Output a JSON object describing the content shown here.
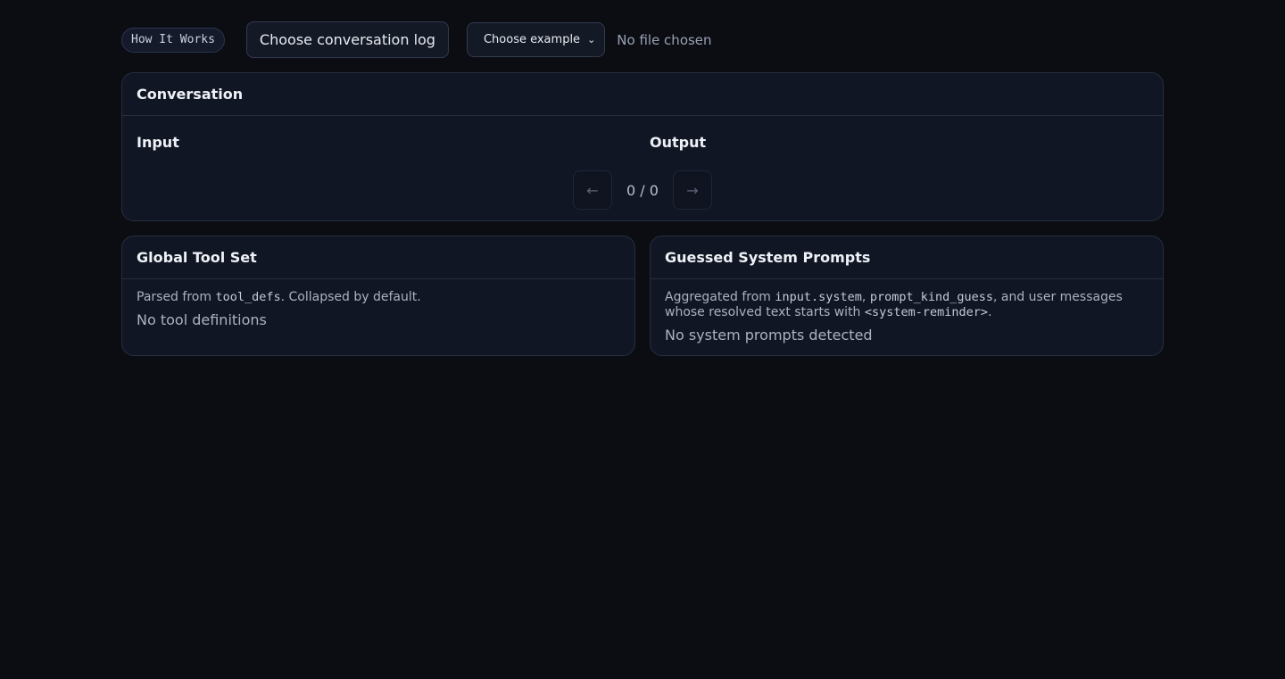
{
  "toolbar": {
    "how_it_works": "How It Works",
    "choose_log": "Choose conversation log",
    "choose_example": "Choose example",
    "no_file": "No file chosen"
  },
  "conversation": {
    "title": "Conversation",
    "input_label": "Input",
    "output_label": "Output",
    "prev": "←",
    "next": "→",
    "counter": "0 / 0"
  },
  "tools": {
    "title": "Global Tool Set",
    "desc_pre": "Parsed from ",
    "desc_code": "tool_defs",
    "desc_post": ". Collapsed by default.",
    "empty": "No tool definitions"
  },
  "prompts": {
    "title": "Guessed System Prompts",
    "desc_1": "Aggregated from ",
    "code_1": "input.system",
    "desc_2": ", ",
    "code_2": "prompt_kind_guess",
    "desc_3": ", and user messages whose resolved text starts with ",
    "code_3": "<system-reminder>",
    "desc_4": ".",
    "empty": "No system prompts detected"
  }
}
